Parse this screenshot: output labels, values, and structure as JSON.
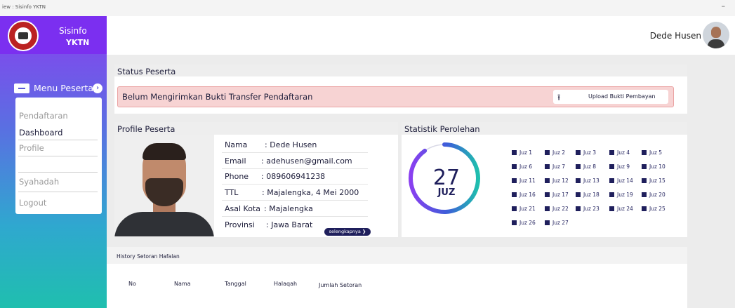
{
  "window": {
    "title": "iew : Sisinfo YKTN",
    "minimize": "–"
  },
  "sidebar": {
    "brand_line1": "Sisinfo",
    "brand_line2": "YKTN",
    "menu_title": "Menu Peserta",
    "items": [
      "Pendaftaran",
      "Dashboard",
      "Profile",
      "Syahadah",
      "Logout"
    ],
    "active_item": "Dashboard"
  },
  "header": {
    "user_name": "Dede Husen"
  },
  "status": {
    "section_title": "Status Peserta",
    "message": "Belum Mengirimkan Bukti Transfer Pendaftaran",
    "upload_label": "Upload Bukti Pembayan"
  },
  "profile": {
    "section_title": "Profile Peserta",
    "rows": [
      {
        "key": "Nama",
        "value": ": Dede Husen"
      },
      {
        "key": "Email",
        "value": ": adehusen@gmail.com"
      },
      {
        "key": "Phone",
        "value": ": 089606941238"
      },
      {
        "key": "TTL",
        "value": ": Majalengka, 4 Mei 2000"
      },
      {
        "key": "Asal Kota",
        "value": ": Majalengka"
      },
      {
        "key": "Provinsi",
        "value": ": Jawa Barat"
      }
    ],
    "more_label": "selengkapnya ❯"
  },
  "statistik": {
    "section_title": "Statistik Perolehan",
    "value": "27",
    "unit": "JUZ",
    "progress_fraction": 0.9,
    "legend": [
      "Juz 1",
      "Juz 2",
      "Juz 3",
      "Juz 4",
      "Juz 5",
      "Juz 6",
      "Juz 7",
      "Juz 8",
      "Juz 9",
      "Juz 10",
      "Juz 11",
      "Juz 12",
      "Juz 13",
      "Juz 14",
      "Juz 15",
      "Juz 16",
      "Juz 17",
      "Juz 18",
      "Juz 19",
      "Juz 20",
      "Juz 21",
      "Juz 22",
      "Juz 23",
      "Juz 24",
      "Juz 25",
      "Juz 26",
      "Juz 27"
    ]
  },
  "history": {
    "section_title": "History Setoran Hafalan",
    "columns": [
      "No",
      "Nama",
      "Tanggal",
      "Halaqah",
      "Jumlah Setoran"
    ]
  },
  "colors": {
    "accent": "#7b2ff0",
    "navy": "#1f1f5c",
    "alert_bg": "#f7d3d3",
    "teal": "#1fbfae"
  }
}
